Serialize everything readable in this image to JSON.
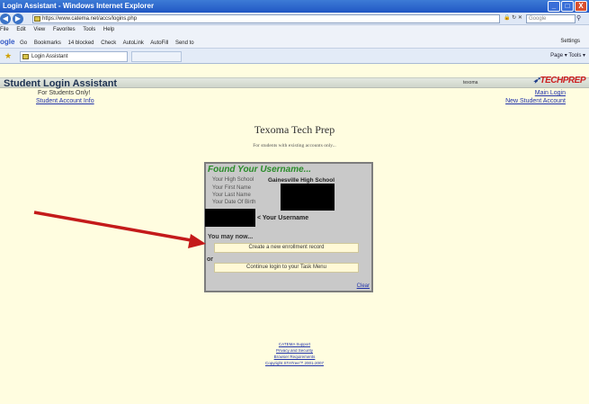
{
  "window": {
    "title": "Login Assistant - Windows Internet Explorer",
    "controls": {
      "minimize": "_",
      "maximize": "□",
      "close": "X"
    }
  },
  "browser": {
    "url": "https://www.catema.net/accs/logins.php",
    "search_placeholder": "Google",
    "menu": [
      "File",
      "Edit",
      "View",
      "Favorites",
      "Tools",
      "Help"
    ],
    "google_toolbar": {
      "brand": "ogle",
      "items": [
        "Go",
        "Bookmarks",
        "14 blocked",
        "Check",
        "AutoLink",
        "AutoFill",
        "Send to"
      ],
      "settings": "Settings"
    },
    "tab_label": "Login Assistant",
    "command_bar": "Page ▾   Tools ▾"
  },
  "page": {
    "header_title": "Student Login Assistant",
    "header_user": "texoma",
    "logo": {
      "part1": "TECH",
      "part2": "PREP"
    },
    "for_students": "For Students Only!",
    "account_info_link": "Student Account Info",
    "main_login_link": "Main Login",
    "new_account_link": "New Student Account",
    "site_title": "Texoma Tech Prep",
    "subnote": "For students with existing accounts only..."
  },
  "panel": {
    "heading": "Found Your Username...",
    "fields": [
      {
        "label": "Your High School",
        "value": "Gainesville High School"
      },
      {
        "label": "Your First Name",
        "value": ""
      },
      {
        "label": "Your Last Name",
        "value": ""
      },
      {
        "label": "Your Date Of Birth",
        "value": ""
      }
    ],
    "username_note": "< Your Username",
    "may_now": "You may now...",
    "action_1": "Create a new enrollment record",
    "or_label": "or",
    "action_2": "Continue login to your Task Menu",
    "clear": "Clear"
  },
  "footer": {
    "links": [
      "CATEMA Support",
      "Privacy and Security",
      "Browser Requirements",
      "Copyright STATree™ 2001-2007"
    ]
  },
  "colors": {
    "page_bg": "#fffde0",
    "panel_bg": "#c9c9c9",
    "found_green": "#2a8c2a",
    "arrow_red": "#c41a1a",
    "link_blue": "#2233aa"
  }
}
